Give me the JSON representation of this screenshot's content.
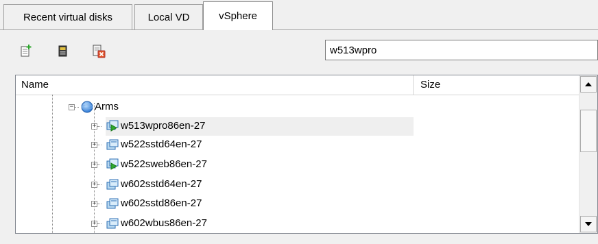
{
  "tabs": [
    {
      "label": "Recent virtual disks",
      "active": false
    },
    {
      "label": "Local VD",
      "active": false
    },
    {
      "label": "vSphere",
      "active": true
    }
  ],
  "toolbar": {
    "icons": [
      "new-disk-icon",
      "disk-properties-icon",
      "delete-disk-icon"
    ],
    "search_value": "w513wpro"
  },
  "tree": {
    "columns": [
      "Name",
      "Size"
    ],
    "root": {
      "label": "Arms",
      "icon": "globe-icon",
      "expanded": true
    },
    "items": [
      {
        "label": "w513wpro86en-27",
        "icon": "vm-running-icon",
        "selected": true
      },
      {
        "label": "w522sstd64en-27",
        "icon": "vm-icon"
      },
      {
        "label": "w522sweb86en-27",
        "icon": "vm-running-icon"
      },
      {
        "label": "w602sstd64en-27",
        "icon": "vm-icon"
      },
      {
        "label": "w602sstd86en-27",
        "icon": "vm-icon"
      },
      {
        "label": "w602wbus86en-27",
        "icon": "vm-icon"
      }
    ]
  },
  "colors": {
    "selection": "#efefef",
    "border": "#828790"
  }
}
